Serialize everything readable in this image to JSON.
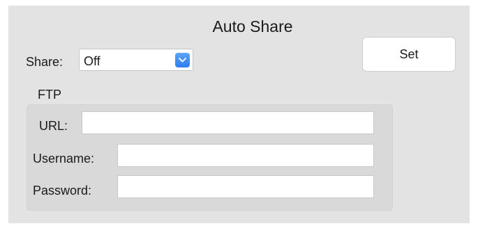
{
  "window": {
    "title": "Auto Share"
  },
  "share": {
    "label": "Share:",
    "selected": "Off"
  },
  "set_button": {
    "label": "Set"
  },
  "ftp": {
    "label": "FTP",
    "url_label": "URL:",
    "url_value": "",
    "username_label": "Username:",
    "username_value": "",
    "password_label": "Password:",
    "password_value": ""
  },
  "colors": {
    "panel_background": "#e3e3e3",
    "group_background": "#d9d9d9",
    "select_arrow_accent": "#2f7ef0"
  },
  "icons": {
    "select_arrow": "chevron-down-icon"
  }
}
